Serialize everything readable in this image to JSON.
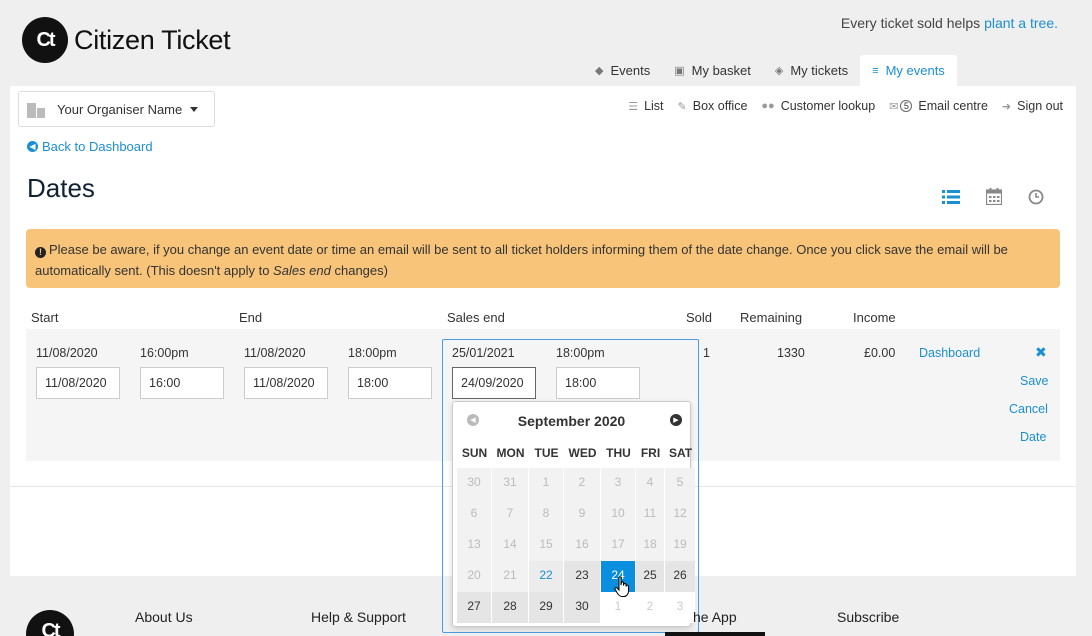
{
  "brand": {
    "name": "Citizen Ticket",
    "mark": "Ct"
  },
  "tagline": {
    "prefix": "Every ticket sold helps ",
    "link": "plant a tree."
  },
  "tabs": [
    {
      "label": "Events",
      "icon": "tag-icon"
    },
    {
      "label": "My basket",
      "icon": "basket-icon"
    },
    {
      "label": "My tickets",
      "icon": "ticket-icon"
    },
    {
      "label": "My events",
      "icon": "sliders-icon",
      "active": true
    }
  ],
  "organiser": {
    "name": "Your Organiser Name"
  },
  "subnav": {
    "list": "List",
    "box_office": "Box office",
    "customer_lookup": "Customer lookup",
    "email_badge": "5",
    "email_centre": "Email centre",
    "sign_out": "Sign out"
  },
  "back_link": "Back to Dashboard",
  "page_title": "Dates",
  "alert": {
    "text_1": "Please be aware, if you change an event date or time an email will be sent to all ticket holders informing them of the date change. Once you click save the email will be automatically sent. (This doesn't apply to ",
    "emph": "Sales end",
    "text_2": " changes)"
  },
  "table": {
    "headers": {
      "start": "Start",
      "end": "End",
      "sales_end": "Sales end",
      "sold": "Sold",
      "remaining": "Remaining",
      "income": "Income"
    },
    "row": {
      "start_date": "11/08/2020",
      "start_time": "16:00pm",
      "end_date": "11/08/2020",
      "end_time": "18:00pm",
      "sales_end_date": "25/01/2021",
      "sales_end_time": "18:00pm",
      "sold": "1",
      "remaining": "1330",
      "income": "£0.00",
      "dashboard": "Dashboard",
      "inputs": {
        "start_date": "11/08/2020",
        "start_time": "16:00",
        "end_date": "11/08/2020",
        "end_time": "18:00",
        "sales_end_date": "24/09/2020",
        "sales_end_time": "18:00"
      },
      "actions": {
        "save": "Save",
        "cancel": "Cancel",
        "date": "Date"
      }
    }
  },
  "datepicker": {
    "month_label": "September 2020",
    "dows": [
      "SUN",
      "MON",
      "TUE",
      "WED",
      "THU",
      "FRI",
      "SAT"
    ],
    "weeks": [
      [
        {
          "d": "30",
          "t": "o"
        },
        {
          "d": "31",
          "t": "o"
        },
        {
          "d": "1",
          "t": "o"
        },
        {
          "d": "2",
          "t": "o"
        },
        {
          "d": "3",
          "t": "o"
        },
        {
          "d": "4",
          "t": "o"
        },
        {
          "d": "5",
          "t": "o"
        }
      ],
      [
        {
          "d": "6",
          "t": "o"
        },
        {
          "d": "7",
          "t": "o"
        },
        {
          "d": "8",
          "t": "o"
        },
        {
          "d": "9",
          "t": "o"
        },
        {
          "d": "10",
          "t": "o"
        },
        {
          "d": "11",
          "t": "o"
        },
        {
          "d": "12",
          "t": "o"
        }
      ],
      [
        {
          "d": "13",
          "t": "o"
        },
        {
          "d": "14",
          "t": "o"
        },
        {
          "d": "15",
          "t": "o"
        },
        {
          "d": "16",
          "t": "o"
        },
        {
          "d": "17",
          "t": "o"
        },
        {
          "d": "18",
          "t": "o"
        },
        {
          "d": "19",
          "t": "o"
        }
      ],
      [
        {
          "d": "20",
          "t": "o"
        },
        {
          "d": "21",
          "t": "o"
        },
        {
          "d": "22",
          "t": "today"
        },
        {
          "d": "23",
          "t": "cur"
        },
        {
          "d": "24",
          "t": "sel"
        },
        {
          "d": "25",
          "t": "cur"
        },
        {
          "d": "26",
          "t": "cur"
        }
      ],
      [
        {
          "d": "27",
          "t": "cur"
        },
        {
          "d": "28",
          "t": "cur"
        },
        {
          "d": "29",
          "t": "cur"
        },
        {
          "d": "30",
          "t": "cur"
        },
        {
          "d": "1",
          "t": "next"
        },
        {
          "d": "2",
          "t": "next"
        },
        {
          "d": "3",
          "t": "next"
        }
      ]
    ]
  },
  "footer": {
    "about": "About Us",
    "help": "Help & Support",
    "app": "he App",
    "subscribe": "Subscribe"
  },
  "colors": {
    "accent": "#1b8fd3",
    "alert": "#f7c47a",
    "selected_day": "#0a8fe0"
  }
}
